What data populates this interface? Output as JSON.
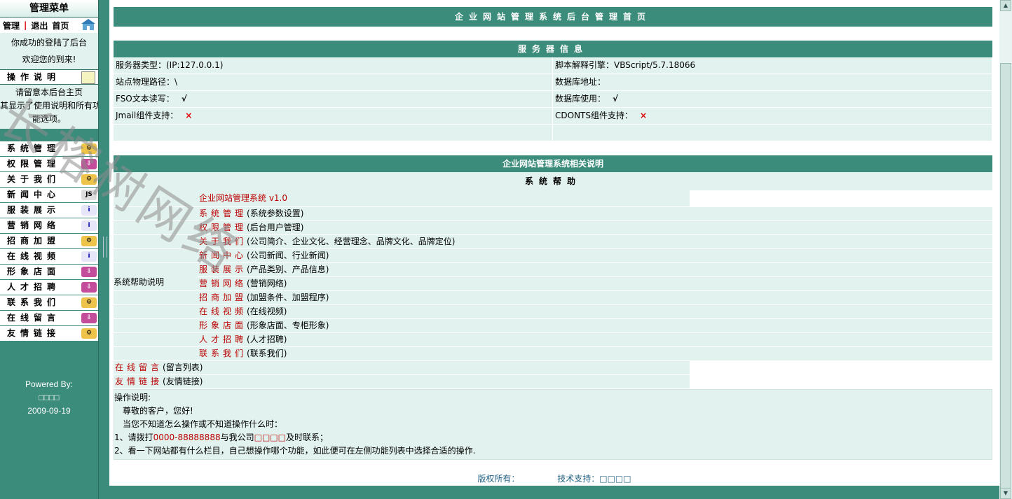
{
  "sidebar": {
    "title": "管理菜单",
    "links": {
      "manage": "管理",
      "sep": "|",
      "logout": "退出",
      "home": "首页"
    },
    "welcome": [
      "你成功的登陆了后台",
      "欢迎您的到来!"
    ],
    "instructions_header": "操作说明",
    "instructions_text": [
      "请留意本后台主页",
      "其显示了使用说明和所有功",
      "能选项。"
    ],
    "menu": [
      {
        "label": "系统管理",
        "icon": "gear-icon"
      },
      {
        "label": "权限管理",
        "icon": "download-icon"
      },
      {
        "label": "关于我们",
        "icon": "gear-icon"
      },
      {
        "label": "新闻中心",
        "icon": "js-icon"
      },
      {
        "label": "服装展示",
        "icon": "info-icon"
      },
      {
        "label": "营销网络",
        "icon": "info-icon"
      },
      {
        "label": "招商加盟",
        "icon": "gear-icon"
      },
      {
        "label": "在线视频",
        "icon": "info-icon"
      },
      {
        "label": "形象店面",
        "icon": "download-icon"
      },
      {
        "label": "人才招聘",
        "icon": "download-icon"
      },
      {
        "label": "联系我们",
        "icon": "gear-icon"
      },
      {
        "label": "在线留言",
        "icon": "download-icon"
      },
      {
        "label": "友情链接",
        "icon": "gear-icon"
      }
    ],
    "powered_by": "Powered By:",
    "powered_name": "□□□□",
    "date": "2009-09-19"
  },
  "main": {
    "page_title": "企业网站管理系统后台管理首页",
    "server_info_title": "服务器信息",
    "server_rows": [
      [
        "服务器类型：(IP:127.0.0.1)",
        "脚本解释引擎：VBScript/5.7.18066"
      ],
      [
        "站点物理路径：\\",
        "数据库地址："
      ],
      [
        "FSO文本读写：",
        "数据库使用："
      ],
      [
        "Jmail组件支持：",
        "CDONTS组件支持："
      ],
      [
        "",
        ""
      ]
    ],
    "marks": {
      "ok": "√",
      "no": "×"
    },
    "about_title": "企业网站管理系统相关说明",
    "help_title": "系统帮助",
    "help_version": "企业网站管理系统 v1.0",
    "help_label": "系统帮助说明",
    "help_items": [
      {
        "name": "系统管理",
        "desc": "(系统参数设置)"
      },
      {
        "name": "权限管理",
        "desc": "(后台用户管理)"
      },
      {
        "name": "关于我们",
        "desc": "(公司简介、企业文化、经营理念、品牌文化、品牌定位)"
      },
      {
        "name": "新闻中心",
        "desc": "(公司新闻、行业新闻)"
      },
      {
        "name": "服装展示",
        "desc": "(产品类别、产品信息)"
      },
      {
        "name": "营销网络",
        "desc": "(营销网络)"
      },
      {
        "name": "招商加盟",
        "desc": "(加盟条件、加盟程序)"
      },
      {
        "name": "在线视频",
        "desc": "(在线视频)"
      },
      {
        "name": "形象店面",
        "desc": "(形象店面、专柜形象)"
      },
      {
        "name": "人才招聘",
        "desc": "(人才招聘)"
      },
      {
        "name": "联系我们",
        "desc": "(联系我们)"
      }
    ],
    "extra_items": [
      {
        "name": "在线留言",
        "desc": "(留言列表)"
      },
      {
        "name": "友情链接",
        "desc": "(友情链接)"
      }
    ],
    "ops": {
      "title": "操作说明:",
      "greet": "尊敬的客户，您好!",
      "line": "当您不知道怎么操作或不知道操作什么时：",
      "step1_pre": "1、请拨打",
      "phone": "0000-88888888",
      "step1_mid": "与我公司",
      "company": "□□□□",
      "step1_post": "及时联系；",
      "step2": "2、看一下网站都有什么栏目，自己想操作哪个功能，如此便可在左侧功能列表中选择合适的操作."
    },
    "footer": {
      "copyright": "版权所有：",
      "support": "技术支持：□□□□"
    }
  },
  "watermark": "长榕树网络"
}
